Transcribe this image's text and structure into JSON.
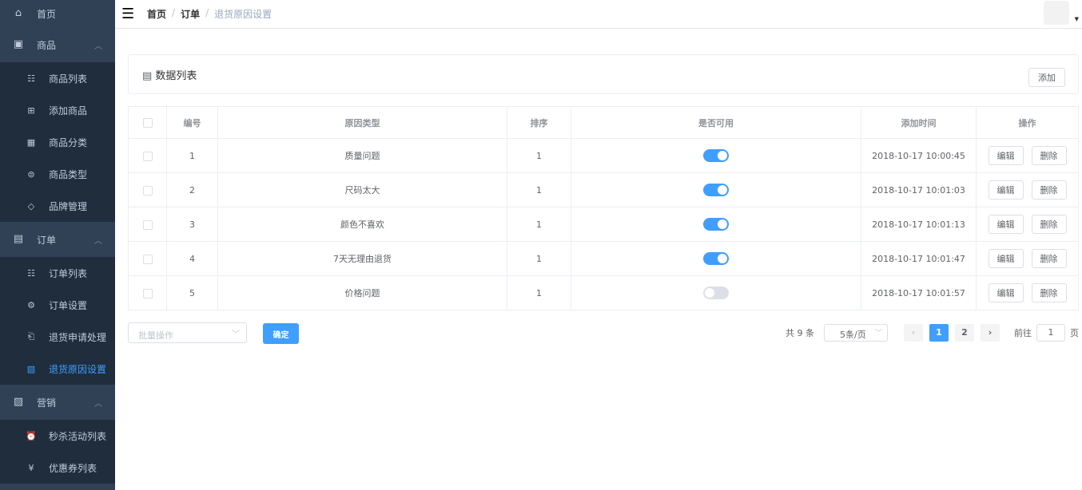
{
  "sidebar": {
    "home": "首页",
    "goods": {
      "label": "商品",
      "items": [
        "商品列表",
        "添加商品",
        "商品分类",
        "商品类型",
        "品牌管理"
      ]
    },
    "order": {
      "label": "订单",
      "items": [
        "订单列表",
        "订单设置",
        "退货申请处理",
        "退货原因设置"
      ]
    },
    "marketing": {
      "label": "营销",
      "items": [
        "秒杀活动列表",
        "优惠券列表"
      ]
    }
  },
  "breadcrumb": [
    "首页",
    "订单",
    "退货原因设置"
  ],
  "card": {
    "title": "数据列表",
    "add": "添加"
  },
  "table": {
    "headers": [
      "编号",
      "原因类型",
      "排序",
      "是否可用",
      "添加时间",
      "操作"
    ],
    "rows": [
      {
        "id": "1",
        "type": "质量问题",
        "sort": "1",
        "enabled": true,
        "time": "2018-10-17 10:00:45"
      },
      {
        "id": "2",
        "type": "尺码太大",
        "sort": "1",
        "enabled": true,
        "time": "2018-10-17 10:01:03"
      },
      {
        "id": "3",
        "type": "颜色不喜欢",
        "sort": "1",
        "enabled": true,
        "time": "2018-10-17 10:01:13"
      },
      {
        "id": "4",
        "type": "7天无理由退货",
        "sort": "1",
        "enabled": true,
        "time": "2018-10-17 10:01:47"
      },
      {
        "id": "5",
        "type": "价格问题",
        "sort": "1",
        "enabled": false,
        "time": "2018-10-17 10:01:57"
      }
    ],
    "edit": "编辑",
    "delete": "删除"
  },
  "batch": {
    "placeholder": "批量操作",
    "confirm": "确定"
  },
  "pagination": {
    "total": "共 9 条",
    "page_size": "5条/页",
    "pages": [
      "1",
      "2"
    ],
    "current": "1",
    "goto": "前往",
    "goto_value": "1",
    "page_unit": "页"
  },
  "colors": {
    "accent": "#409EFF",
    "sidebar": "#304156",
    "submenu": "#1f2d3d"
  }
}
